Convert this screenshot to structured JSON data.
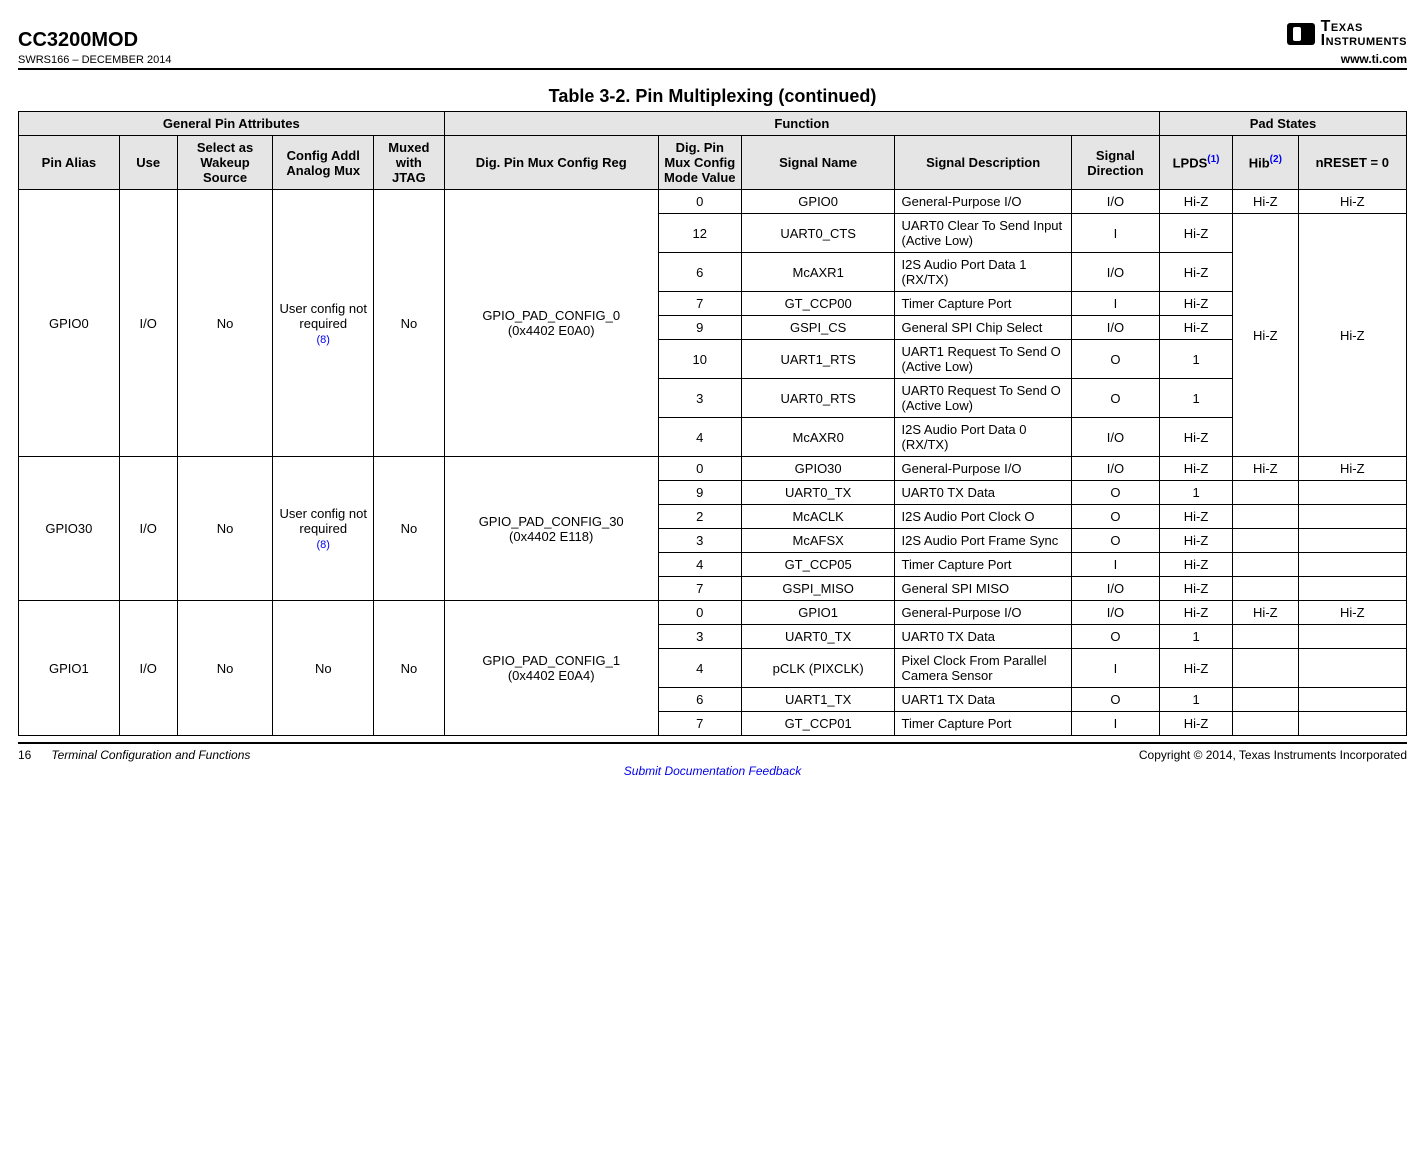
{
  "header": {
    "part": "CC3200MOD",
    "doc_id": "SWRS166 – DECEMBER 2014",
    "brand_line1": "Texas",
    "brand_line2": "Instruments",
    "url": "www.ti.com"
  },
  "table_title": "Table 3-2. Pin Multiplexing (continued)",
  "column_groups": {
    "g1": "General Pin Attributes",
    "g2": "Function",
    "g3": "Pad States"
  },
  "columns": {
    "pin_alias": "Pin Alias",
    "use": "Use",
    "wakeup": "Select as Wakeup Source",
    "cfg_mux": "Config Addl Analog Mux",
    "jtag": "Muxed with JTAG",
    "reg": "Dig. Pin Mux Config Reg",
    "mode": "Dig. Pin Mux Config Mode Value",
    "signal": "Signal Name",
    "desc": "Signal Description",
    "dir": "Signal Direction",
    "lpds": "LPDS",
    "lpds_ref": "(1)",
    "hib": "Hib",
    "hib_ref": "(2)",
    "nreset": "nRESET = 0"
  },
  "config_required_line1": "User config not required",
  "config_required_ref": "(8)",
  "no_value": "No",
  "pins": [
    {
      "alias": "GPIO0",
      "use": "I/O",
      "wakeup": "No",
      "jtag": "No",
      "reg_line1": "GPIO_PAD_CONFIG_0",
      "reg_line2": "(0x4402 E0A0)",
      "rows": [
        {
          "mode": "0",
          "signal": "GPIO0",
          "desc": "General-Purpose I/O",
          "dir": "I/O",
          "lpds": "Hi-Z",
          "hib": "Hi-Z",
          "nreset": "Hi-Z"
        },
        {
          "mode": "12",
          "signal": "UART0_CTS",
          "desc": "UART0 Clear To Send Input (Active Low)",
          "dir": "I",
          "lpds": "Hi-Z",
          "hib": "Hi-Z",
          "nreset": "Hi-Z"
        },
        {
          "mode": "6",
          "signal": "McAXR1",
          "desc": "I2S Audio Port Data 1 (RX/TX)",
          "dir": "I/O",
          "lpds": "Hi-Z",
          "hib": "",
          "nreset": ""
        },
        {
          "mode": "7",
          "signal": "GT_CCP00",
          "desc": "Timer Capture Port",
          "dir": "I",
          "lpds": "Hi-Z",
          "hib": "",
          "nreset": ""
        },
        {
          "mode": "9",
          "signal": "GSPI_CS",
          "desc": "General SPI Chip Select",
          "dir": "I/O",
          "lpds": "Hi-Z",
          "hib": "",
          "nreset": ""
        },
        {
          "mode": "10",
          "signal": "UART1_RTS",
          "desc": "UART1 Request To Send O (Active Low)",
          "dir": "O",
          "lpds": "1",
          "hib": "",
          "nreset": ""
        },
        {
          "mode": "3",
          "signal": "UART0_RTS",
          "desc": "UART0 Request To Send O (Active Low)",
          "dir": "O",
          "lpds": "1",
          "hib": "",
          "nreset": ""
        },
        {
          "mode": "4",
          "signal": "McAXR0",
          "desc": "I2S Audio Port Data 0 (RX/TX)",
          "dir": "I/O",
          "lpds": "Hi-Z",
          "hib": "",
          "nreset": ""
        }
      ]
    },
    {
      "alias": "GPIO30",
      "use": "I/O",
      "wakeup": "No",
      "jtag": "No",
      "reg_line1": "GPIO_PAD_CONFIG_30",
      "reg_line2": "(0x4402 E118)",
      "rows": [
        {
          "mode": "0",
          "signal": "GPIO30",
          "desc": "General-Purpose I/O",
          "dir": "I/O",
          "lpds": "Hi-Z",
          "hib": "Hi-Z",
          "nreset": "Hi-Z"
        },
        {
          "mode": "9",
          "signal": "UART0_TX",
          "desc": "UART0 TX Data",
          "dir": "O",
          "lpds": "1",
          "hib": "",
          "nreset": ""
        },
        {
          "mode": "2",
          "signal": "McACLK",
          "desc": "I2S Audio Port Clock O",
          "dir": "O",
          "lpds": "Hi-Z",
          "hib": "",
          "nreset": ""
        },
        {
          "mode": "3",
          "signal": "McAFSX",
          "desc": "I2S Audio Port Frame Sync",
          "dir": "O",
          "lpds": "Hi-Z",
          "hib": "",
          "nreset": ""
        },
        {
          "mode": "4",
          "signal": "GT_CCP05",
          "desc": "Timer Capture Port",
          "dir": "I",
          "lpds": "Hi-Z",
          "hib": "",
          "nreset": ""
        },
        {
          "mode": "7",
          "signal": "GSPI_MISO",
          "desc": "General SPI MISO",
          "dir": "I/O",
          "lpds": "Hi-Z",
          "hib": "",
          "nreset": ""
        }
      ]
    },
    {
      "alias": "GPIO1",
      "use": "I/O",
      "wakeup": "No",
      "cfg_mux_text": "No",
      "jtag": "No",
      "reg_line1": "GPIO_PAD_CONFIG_1",
      "reg_line2": "(0x4402 E0A4)",
      "rows": [
        {
          "mode": "0",
          "signal": "GPIO1",
          "desc": "General-Purpose I/O",
          "dir": "I/O",
          "lpds": "Hi-Z",
          "hib": "Hi-Z",
          "nreset": "Hi-Z"
        },
        {
          "mode": "3",
          "signal": "UART0_TX",
          "desc": "UART0 TX Data",
          "dir": "O",
          "lpds": "1",
          "hib": "",
          "nreset": ""
        },
        {
          "mode": "4",
          "signal": "pCLK (PIXCLK)",
          "desc": "Pixel Clock From Parallel Camera Sensor",
          "dir": "I",
          "lpds": "Hi-Z",
          "hib": "",
          "nreset": ""
        },
        {
          "mode": "6",
          "signal": "UART1_TX",
          "desc": "UART1 TX Data",
          "dir": "O",
          "lpds": "1",
          "hib": "",
          "nreset": ""
        },
        {
          "mode": "7",
          "signal": "GT_CCP01",
          "desc": "Timer Capture Port",
          "dir": "I",
          "lpds": "Hi-Z",
          "hib": "",
          "nreset": ""
        }
      ]
    }
  ],
  "footer": {
    "page_num": "16",
    "section": "Terminal Configuration and Functions",
    "copyright": "Copyright © 2014, Texas Instruments Incorporated",
    "feedback": "Submit Documentation Feedback"
  }
}
